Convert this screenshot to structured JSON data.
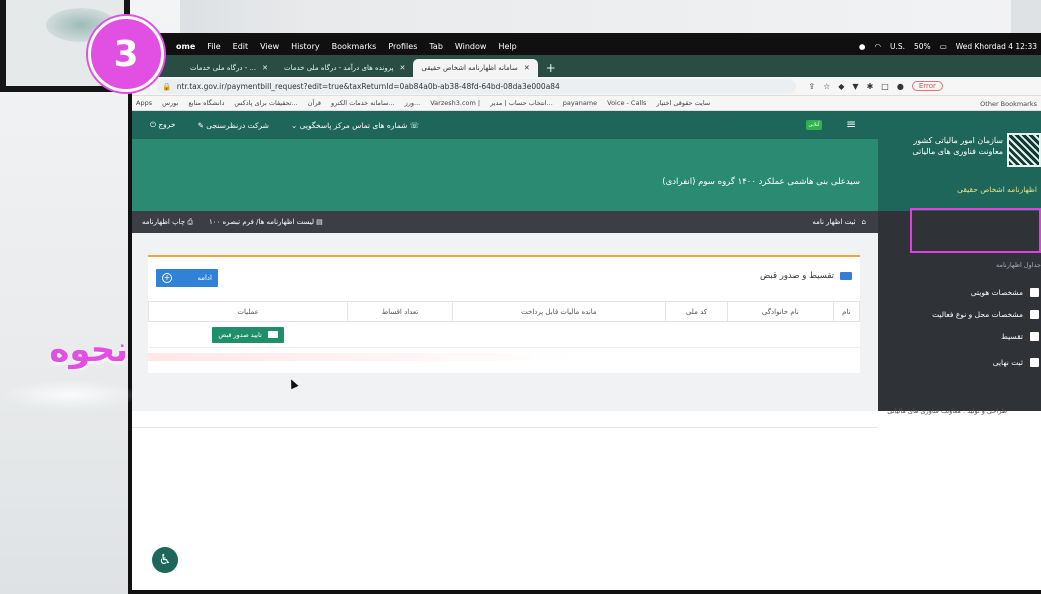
{
  "menubar": {
    "app": "ome",
    "items": [
      "File",
      "Edit",
      "View",
      "History",
      "Bookmarks",
      "Profiles",
      "Tab",
      "Window",
      "Help"
    ],
    "status": [
      "U.S.",
      "50%",
      "Wed Khordad 4 12:33"
    ]
  },
  "tabs": [
    {
      "label": "درگاه ملی خدمات - ...",
      "active": false
    },
    {
      "label": "پرونده های درآمد - درگاه ملی خدمات",
      "active": false
    },
    {
      "label": "سامانه اظهارنامه اشخاص حقیقی",
      "active": true
    }
  ],
  "address": {
    "url": "ntr.tax.gov.ir/paymentbill_request?edit=true&taxReturnId=0ab84a0b-ab38-48fd-64bd-08da3e000a84",
    "error_label": "Error"
  },
  "bookmarks": {
    "items": [
      "Apps",
      "بورس",
      "دانشگاه منابع",
      "تحقیقات برای پادکس...",
      "قرآن",
      "سامانه خدمات الکترو...",
      "ورز...",
      "Varzesh3.com |",
      "انتخاب حساب | مدیر...",
      "payaname",
      "Voice - Calls",
      "سایت حقوقی اختیار"
    ],
    "other": "Other Bookmarks"
  },
  "site": {
    "top_links": {
      "exit": "خروج",
      "survey": "شرکت درنظرسنجی",
      "phones": "شماره های تماس مرکز پاسخگویی"
    },
    "online_badge": "آنلاین",
    "hero_title": "سیدعلی بنی هاشمی   عملکرد ۱۴۰۰   گروه سوم   (انفرادی)",
    "brand": {
      "line1": "سازمان امور مالیاتی کشور",
      "line2": "معاونت فناوری های مالیاتی",
      "subtitle": "اظهارنامه اشخاص حقیقی"
    },
    "breadcrumb": {
      "home": "ثبت اظهار نامه",
      "list": "لیست اظهارنامه ها/ فرم تبصره ۱۰۰",
      "print": "چاپ اظهارنامه"
    },
    "sidebar": {
      "heading": "جداول اظهارنامه",
      "items": [
        "مشخصات هویتی",
        "مشخصات محل و نوع فعالیت",
        "تقسیط",
        "ثبت نهایی"
      ]
    },
    "panel": {
      "title": "تقسیط و صدور قبض",
      "continue_label": "ادامه",
      "columns": [
        "نام",
        "نام خانوادگی",
        "کد ملی",
        "مانده مالیات قابل پرداخت",
        "تعداد اقساط",
        "عملیات"
      ],
      "confirm_label": "تایید صدور قبض"
    },
    "footer": "طراحی و تولید : معاونت فناوری های مالیاتی"
  },
  "overlay": {
    "step_number": "3",
    "caption": "نحوه"
  },
  "colors": {
    "accent": "#e14fe3",
    "header_green": "#1e665a",
    "hero_green": "#2b8a72",
    "button_blue": "#2f82d6",
    "confirm_green": "#1f8f6a"
  }
}
